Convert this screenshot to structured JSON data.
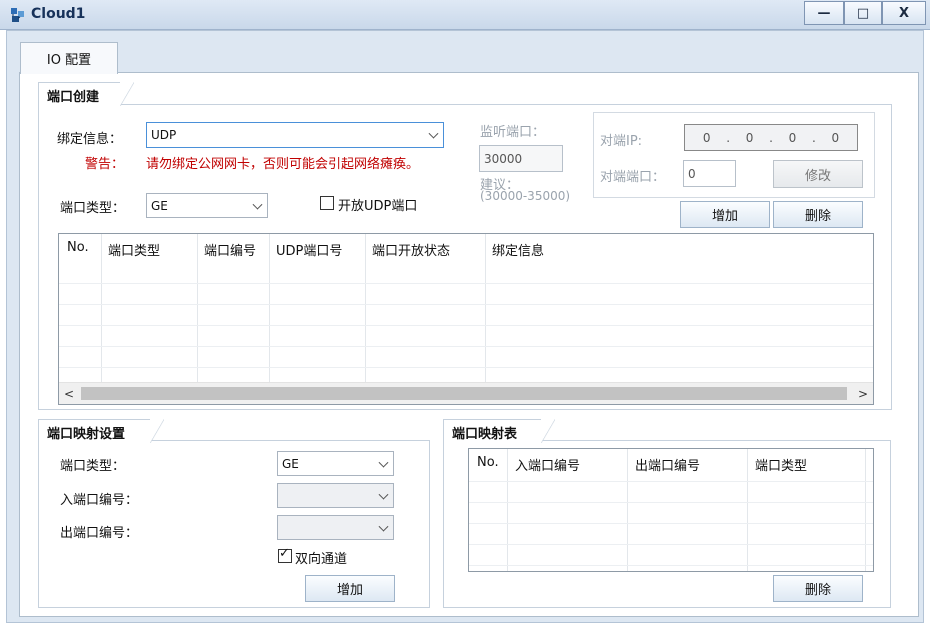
{
  "window": {
    "title": "Cloud1",
    "min": "—",
    "max": "□",
    "close": "X"
  },
  "tabs": [
    {
      "label": "IO 配置"
    }
  ],
  "port_create": {
    "title": "端口创建",
    "bind_label": "绑定信息：",
    "bind_value": "UDP",
    "warning_label": "警告：",
    "warning_text": "请勿绑定公网网卡，否则可能会引起网络瘫痪。",
    "port_type_label": "端口类型：",
    "port_type_value": "GE",
    "open_udp_label": "开放UDP端口",
    "open_udp_checked": false,
    "listen_port_label": "监听端口：",
    "listen_port_value": "30000",
    "suggest_label": "建议：",
    "suggest_range": "(30000-35000)",
    "peer_ip_label": "对端IP:",
    "peer_ip": [
      "0",
      "0",
      "0",
      "0"
    ],
    "peer_port_label": "对端端口：",
    "peer_port_value": "0",
    "modify_button": "修改",
    "add_button": "增加",
    "delete_button": "删除",
    "table": {
      "columns": [
        "No.",
        "端口类型",
        "端口编号",
        "UDP端口号",
        "端口开放状态",
        "绑定信息"
      ],
      "rows": []
    }
  },
  "port_mapping": {
    "title": "端口映射设置",
    "port_type_label": "端口类型：",
    "port_type_value": "GE",
    "in_port_label": "入端口编号：",
    "in_port_value": "",
    "out_port_label": "出端口编号：",
    "out_port_value": "",
    "bidirectional_label": "双向通道",
    "bidirectional_checked": true,
    "add_button": "增加"
  },
  "mapping_table": {
    "title": "端口映射表",
    "columns": [
      "No.",
      "入端口编号",
      "出端口编号",
      "端口类型"
    ],
    "rows": [],
    "delete_button": "删除"
  }
}
